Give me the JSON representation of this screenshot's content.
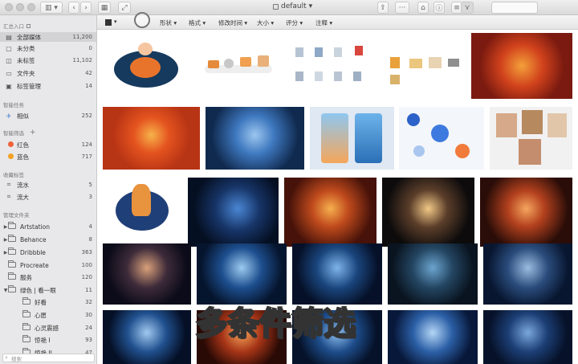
{
  "window": {
    "title": "default"
  },
  "sidebar": {
    "sections": {
      "summary": "汇总入口",
      "smart_tasks": "智能任务",
      "smart_filters": "智能筛选",
      "favorite_tags": "收藏标签",
      "manage_folders": "管理文件夹"
    },
    "summary_items": [
      {
        "label": "全部媒体",
        "count": "11,200"
      },
      {
        "label": "未分类",
        "count": "0"
      },
      {
        "label": "未标签",
        "count": "11,102"
      },
      {
        "label": "文件夹",
        "count": "42"
      },
      {
        "label": "标签管理",
        "count": "14"
      }
    ],
    "task_items": [
      {
        "label": "相似",
        "count": "252"
      }
    ],
    "filter_items": [
      {
        "label": "红色",
        "count": "124",
        "color": "#f0623a"
      },
      {
        "label": "蓝色",
        "count": "717",
        "color": "#f3a223"
      }
    ],
    "tag_items": [
      {
        "label": "流水",
        "count": "5"
      },
      {
        "label": "流大",
        "count": "3"
      }
    ],
    "folder_items": [
      {
        "label": "Artstation",
        "count": "4"
      },
      {
        "label": "Behance",
        "count": "8"
      },
      {
        "label": "Dribbble",
        "count": "363"
      },
      {
        "label": "Procreate",
        "count": "100"
      },
      {
        "label": "服务",
        "count": "120"
      },
      {
        "label": "绿色 | 看一眼",
        "count": "11"
      },
      {
        "label": "好看",
        "count": "32"
      },
      {
        "label": "心愿",
        "count": "30"
      },
      {
        "label": "心灵震撼",
        "count": "24"
      },
      {
        "label": "惊艳 I",
        "count": "93"
      },
      {
        "label": "惊艳 II",
        "count": "47"
      }
    ],
    "search_placeholder": "搜索"
  },
  "filterbar": {
    "items": [
      "形状",
      "格式",
      "修改时间",
      "大小",
      "评分",
      "注释"
    ]
  },
  "caption": "多条件筛选"
}
